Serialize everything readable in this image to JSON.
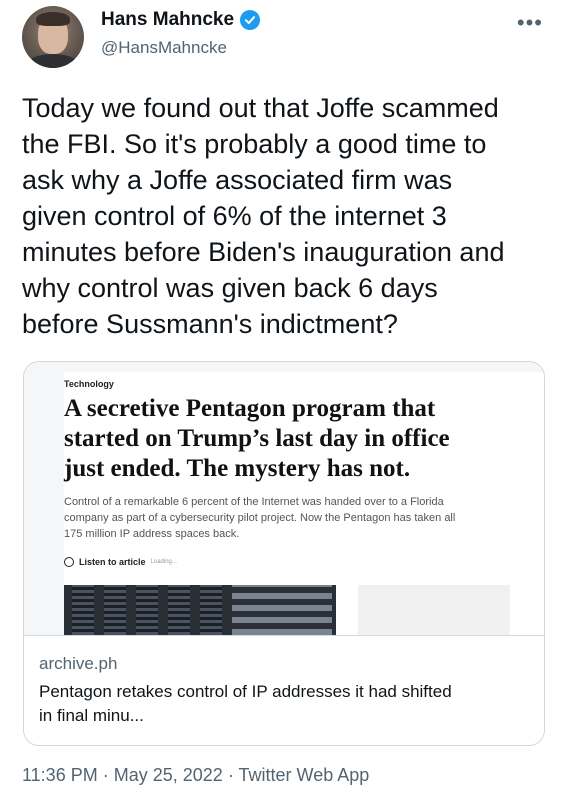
{
  "author": {
    "display_name": "Hans Mahncke",
    "handle": "@HansMahncke"
  },
  "tweet": {
    "text_lines": [
      "Today we found out that Joffe scammed",
      "the FBI. So it's probably a good time to",
      "ask why a Joffe associated firm was",
      "given control of 6% of the internet 3",
      "minutes before Biden's inauguration and",
      "why control was given back 6 days",
      "before Sussmann's indictment?"
    ]
  },
  "card": {
    "article": {
      "section": "Technology",
      "headline_lines": [
        "A secretive Pentagon program that",
        "started on Trump’s last day in office",
        "just ended. The mystery has not."
      ],
      "dek_lines": [
        "Control of a remarkable 6 percent of the Internet was handed over to a Florida",
        "company as part of a cybersecurity pilot project. Now the Pentagon has taken all",
        "175 million IP address spaces back."
      ],
      "listen_label": "Listen to article",
      "listen_status": "Loading..."
    },
    "domain": "archive.ph",
    "title_lines": [
      "Pentagon retakes control of IP addresses it had shifted",
      "in final minu..."
    ]
  },
  "meta": {
    "time": "11:36 PM",
    "separator": "·",
    "date": "May 25, 2022",
    "app": "Twitter Web App"
  },
  "colors": {
    "verified_badge": "#1d9bf0",
    "secondary_text": "#536471",
    "primary_text": "#0f1419",
    "border": "#cfd9de"
  },
  "icons": {
    "verified": "verified-badge-icon",
    "more": "more-horizontal-icon",
    "listen": "play-circle-icon"
  }
}
